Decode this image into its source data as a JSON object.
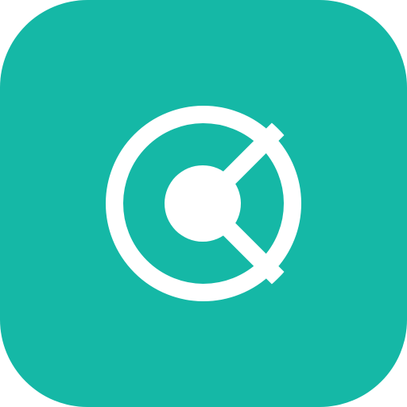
{
  "app_icon": {
    "glyph": "circle-slice-logo-icon",
    "colors": {
      "tile": "#15B8A6",
      "glyph": "#FFFFFF",
      "page_background": "#FFFFFF"
    }
  }
}
